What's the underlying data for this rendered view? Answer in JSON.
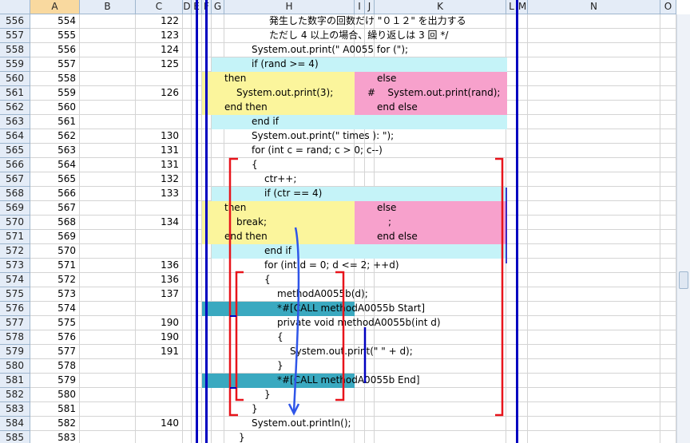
{
  "columns": [
    {
      "label": "A",
      "selected": true
    },
    {
      "label": "B"
    },
    {
      "label": "C"
    },
    {
      "label": "D"
    },
    {
      "label": "E"
    },
    {
      "label": "F"
    },
    {
      "label": "G"
    },
    {
      "label": "H"
    },
    {
      "label": "I"
    },
    {
      "label": "J"
    },
    {
      "label": "K"
    },
    {
      "label": "L"
    },
    {
      "label": "M"
    },
    {
      "label": "N"
    },
    {
      "label": "O"
    }
  ],
  "rows": [
    {
      "r": "556",
      "a": "554",
      "c": "122",
      "code": "発生した数字の回数だけ \"０１２\" を出力する",
      "codeCol": "H",
      "indent": 3
    },
    {
      "r": "557",
      "a": "555",
      "c": "123",
      "code": "ただし 4 以上の場合、繰り返しは 3 回 */",
      "codeCol": "H",
      "indent": 3
    },
    {
      "r": "558",
      "a": "556",
      "c": "124",
      "code": "System.out.print(\" A0055 for (\");",
      "codeCol": "H",
      "indent": 2
    },
    {
      "r": "559",
      "a": "557",
      "c": "125",
      "code": "if (rand >= 4)",
      "codeCol": "H",
      "indent": 2
    },
    {
      "r": "560",
      "a": "558",
      "c": "",
      "left": "then",
      "right": "else"
    },
    {
      "r": "561",
      "a": "559",
      "c": "126",
      "left": "System.out.print(3);",
      "right": "#    System.out.print(rand);"
    },
    {
      "r": "562",
      "a": "560",
      "c": "",
      "left": "end then",
      "right": "end else"
    },
    {
      "r": "563",
      "a": "561",
      "c": "",
      "code": "end if",
      "codeCol": "H",
      "indent": 2
    },
    {
      "r": "564",
      "a": "562",
      "c": "130",
      "code": "System.out.print(\" times ): \");",
      "codeCol": "H",
      "indent": 2
    },
    {
      "r": "565",
      "a": "563",
      "c": "131",
      "code": "for (int c = rand; c > 0; c--)",
      "codeCol": "H",
      "indent": 2
    },
    {
      "r": "566",
      "a": "564",
      "c": "131",
      "code": "{",
      "codeCol": "H",
      "indent": 2
    },
    {
      "r": "567",
      "a": "565",
      "c": "132",
      "code": "ctr++;",
      "codeCol": "H",
      "indent": 3
    },
    {
      "r": "568",
      "a": "566",
      "c": "133",
      "code": "if (ctr == 4)",
      "codeCol": "H",
      "indent": 3
    },
    {
      "r": "569",
      "a": "567",
      "c": "",
      "left": "then",
      "right": "else"
    },
    {
      "r": "570",
      "a": "568",
      "c": "134",
      "left": "break;",
      "right": ";"
    },
    {
      "r": "571",
      "a": "569",
      "c": "",
      "left": "end then",
      "right": "end else"
    },
    {
      "r": "572",
      "a": "570",
      "c": "",
      "code": "end if",
      "codeCol": "H",
      "indent": 3
    },
    {
      "r": "573",
      "a": "571",
      "c": "136",
      "code": "for (int d = 0; d <= 2; ++d)",
      "codeCol": "H",
      "indent": 3
    },
    {
      "r": "574",
      "a": "572",
      "c": "136",
      "code": "{",
      "codeCol": "H",
      "indent": 3
    },
    {
      "r": "575",
      "a": "573",
      "c": "137",
      "code": "methodA0055b(d);",
      "codeCol": "H",
      "indent": 4
    },
    {
      "r": "576",
      "a": "574",
      "c": "",
      "code": "*#[CALL methodA0055b Start]",
      "codeCol": "H",
      "indent": 4
    },
    {
      "r": "577",
      "a": "575",
      "c": "190",
      "code": "private void methodA0055b(int d)",
      "codeCol": "H",
      "indent": 4
    },
    {
      "r": "578",
      "a": "576",
      "c": "190",
      "code": "{",
      "codeCol": "H",
      "indent": 4
    },
    {
      "r": "579",
      "a": "577",
      "c": "191",
      "code": "System.out.print(\" \" + d);",
      "codeCol": "H",
      "indent": 5
    },
    {
      "r": "580",
      "a": "578",
      "c": "",
      "code": "}",
      "codeCol": "H",
      "indent": 4
    },
    {
      "r": "581",
      "a": "579",
      "c": "",
      "code": "*#[CALL methodA0055b End]",
      "codeCol": "H",
      "indent": 4
    },
    {
      "r": "582",
      "a": "580",
      "c": "",
      "code": "}",
      "codeCol": "H",
      "indent": 3
    },
    {
      "r": "583",
      "a": "581",
      "c": "",
      "code": "}",
      "codeCol": "H",
      "indent": 2
    },
    {
      "r": "584",
      "a": "582",
      "c": "140",
      "code": "System.out.println();",
      "codeCol": "H",
      "indent": 2
    },
    {
      "r": "585",
      "a": "583",
      "c": "",
      "code": "}",
      "codeCol": "H",
      "indent": 1
    }
  ],
  "colors": {
    "cyan": "#c5f3f8",
    "yellow": "#fbf59c",
    "pink": "#f7a1cc",
    "teal": "#3aa9c0",
    "red": "#e8141b",
    "blue": "#0000c0",
    "arrow": "#2f55e8"
  }
}
